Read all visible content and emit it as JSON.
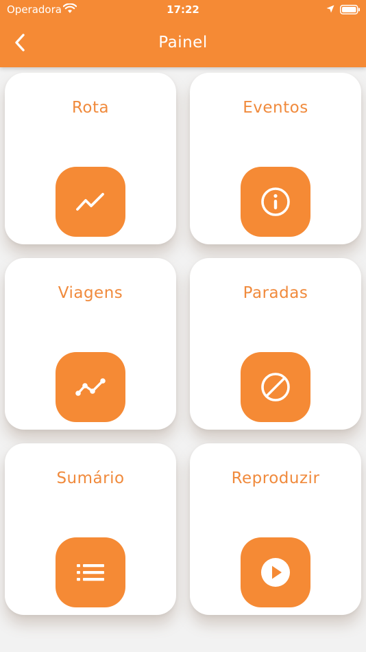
{
  "status_bar": {
    "carrier": "Operadora",
    "time": "17:22",
    "icons": [
      "wifi-icon",
      "location-arrow-icon",
      "battery-icon"
    ]
  },
  "header": {
    "title": "Painel",
    "back_icon": "chevron-left-icon"
  },
  "colors": {
    "accent": "#f58a35",
    "card_background": "#ffffff",
    "page_background": "#f2f2f2"
  },
  "cards": [
    {
      "label": "Rota",
      "icon": "route-trend-icon"
    },
    {
      "label": "Eventos",
      "icon": "info-icon"
    },
    {
      "label": "Viagens",
      "icon": "trips-line-icon"
    },
    {
      "label": "Paradas",
      "icon": "stop-block-icon"
    },
    {
      "label": "Sumário",
      "icon": "list-icon"
    },
    {
      "label": "Reproduzir",
      "icon": "play-icon"
    }
  ]
}
